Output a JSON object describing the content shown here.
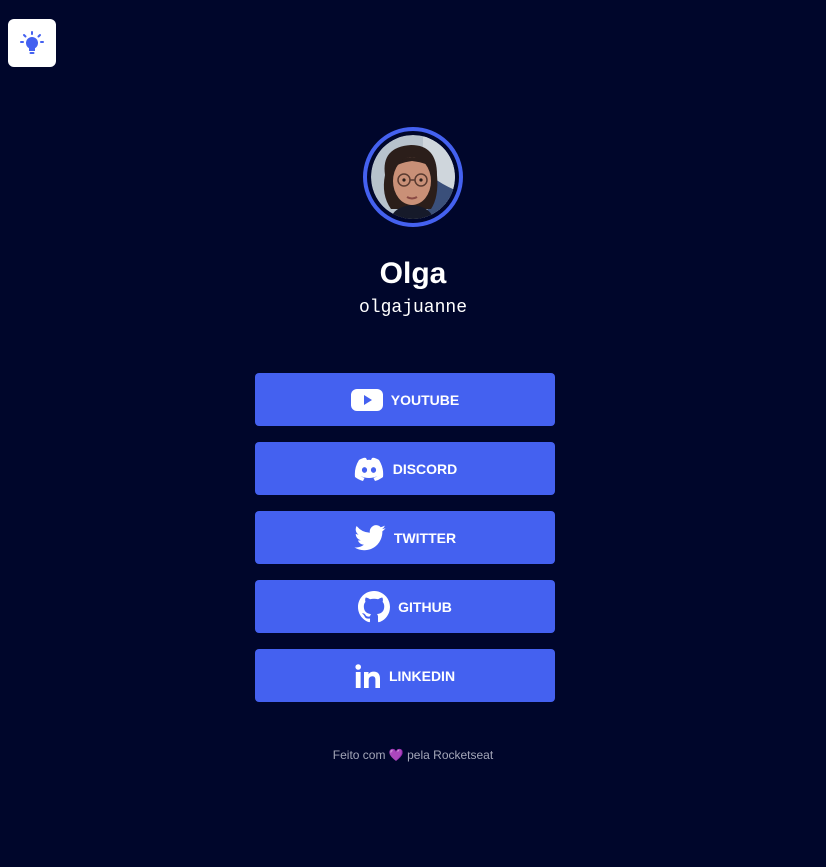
{
  "theme_toggle": {
    "icon": "lightbulb-icon"
  },
  "profile": {
    "name": "Olga",
    "username": "olgajuanne",
    "avatar": "profile-photo"
  },
  "links": [
    {
      "label": "YOUTUBE",
      "icon": "youtube-icon"
    },
    {
      "label": "DISCORD",
      "icon": "discord-icon"
    },
    {
      "label": "TWITTER",
      "icon": "twitter-icon"
    },
    {
      "label": "GITHUB",
      "icon": "github-icon"
    },
    {
      "label": "LINKEDIN",
      "icon": "linkedin-icon"
    }
  ],
  "footer": {
    "prefix": "Feito com",
    "heart": "💜",
    "suffix": "pela Rocketseat"
  },
  "colors": {
    "background": "#00062b",
    "accent": "#4461f0",
    "text": "#ffffff"
  }
}
